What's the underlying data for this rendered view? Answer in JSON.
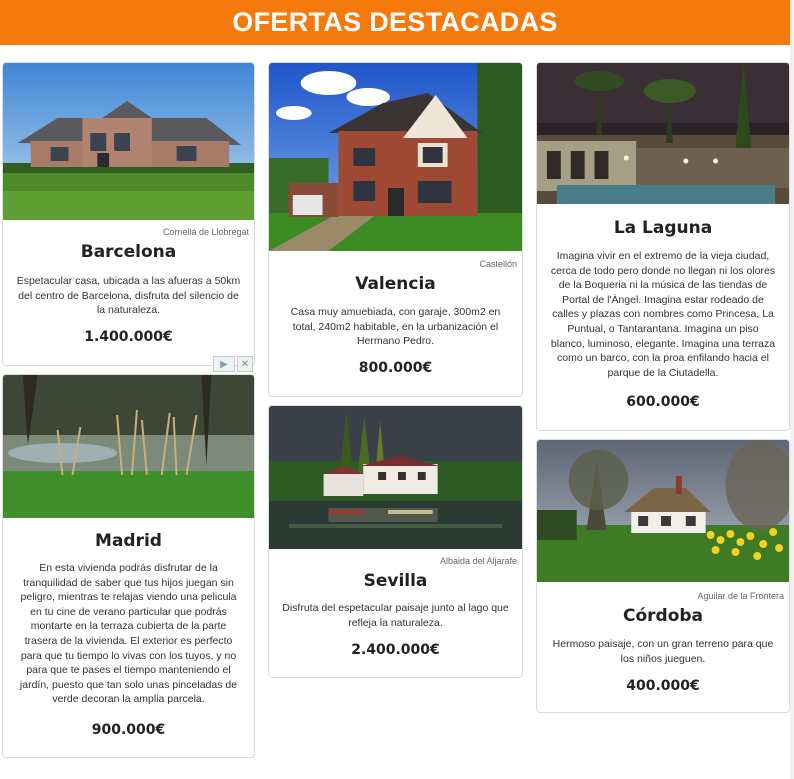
{
  "header": {
    "title": "OFERTAS DESTACADAS"
  },
  "listings": [
    {
      "id": "barcelona",
      "location": "Cornellá de Llobregat",
      "city": "Barcelona",
      "description": "Espetacular casa, ubicada a las afueras a 50km del centro de Barcelona, disfruta del silencio de la naturaleza.",
      "price": "1.400.000€"
    },
    {
      "id": "valencia",
      "location": "Castellón",
      "city": "Valencia",
      "description": "Casa muy amuebiada, con garaje, 300m2 en total, 240m2 habitable, en la urbanización el Hermano Pedro.",
      "price": "800.000€"
    },
    {
      "id": "la-laguna",
      "location": "",
      "city": "La Laguna",
      "description": "Imagina vivir en el extremo de la vieja ciudad, cerca de todo pero donde no llegan ni los olores de la Boqueria ni la música de las tiendas de Portal de l'Àngel. Imagina estar rodeado de calles y plazas con nombres como Princesa, La Puntual, o Tantarantana. Imagina un piso blanco, luminoso, elegante. Imagina una terraza como un barco, con la proa enfilando hacia el parque de la Ciutadella.",
      "price": "600.000€"
    },
    {
      "id": "madrid",
      "location": "",
      "city": "Madrid",
      "description": "En esta vivienda podrás disfrutar de la tranquilidad de saber que tus hijos juegan sin peligro, mientras te relajas viendo una pelicula en tu cine de verano particular que podrás montarte en la terraza cubierta de la parte trasera de la vivienda. El exterior es perfecto para que tu tiempo lo vivas con los tuyos, y no para que te pases el tiempo manteniendo el jardín, puesto que tan solo unas pinceladas de verde decoran la amplia parcela.",
      "price": "900.000€"
    },
    {
      "id": "sevilla",
      "location": "Albaida del Aljarafe",
      "city": "Sevilla",
      "description": "Disfruta del espetacular paisaje junto al lago que refleja la naturaleza.",
      "price": "2.400.000€"
    },
    {
      "id": "cordoba",
      "location": "Aguilar de la Frontera",
      "city": "Córdoba",
      "description": "Hermoso paisaje, con un gran terreno para que los niños jueguen.",
      "price": "400.000€"
    }
  ],
  "ad": {
    "play_glyph": "▶",
    "close_glyph": "✕"
  }
}
